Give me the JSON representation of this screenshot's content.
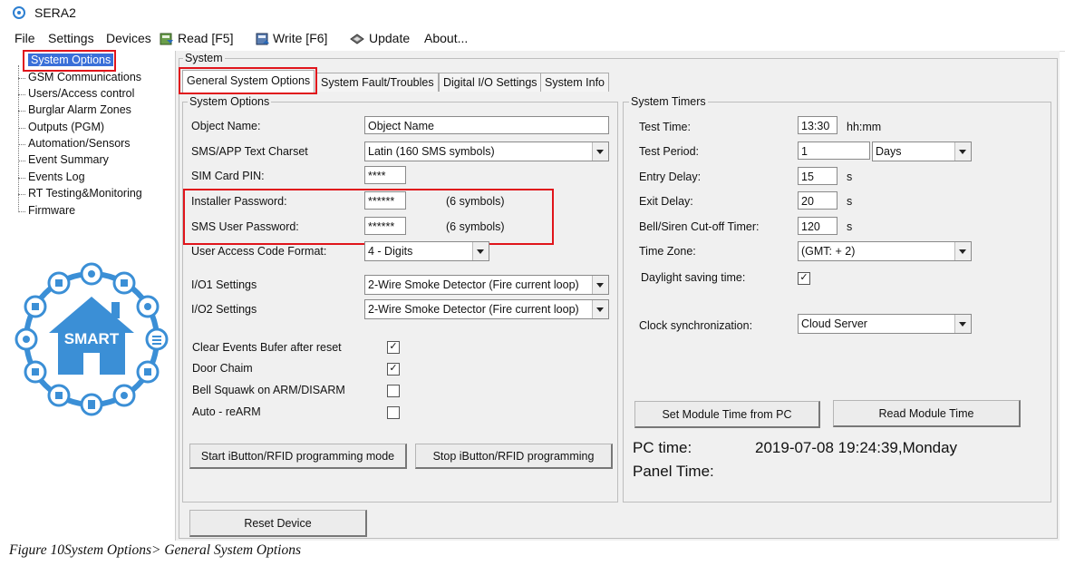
{
  "app": {
    "title": "SERA2"
  },
  "menu": {
    "file": "File",
    "settings": "Settings",
    "devices": "Devices",
    "read": "Read [F5]",
    "write": "Write [F6]",
    "update": "Update",
    "about": "About..."
  },
  "sidebar": {
    "items": [
      "System Options",
      "GSM Communications",
      "Users/Access control",
      "Burglar Alarm Zones",
      "Outputs (PGM)",
      "Automation/Sensors",
      "Event Summary",
      "Events Log",
      "RT Testing&Monitoring",
      "Firmware"
    ],
    "graphic_text": "SMART"
  },
  "main": {
    "group_title": "System",
    "tabs": [
      "General System Options",
      "System Fault/Troubles",
      "Digital I/O Settings",
      "System Info"
    ],
    "system_options": {
      "title": "System Options",
      "object_name_label": "Object Name:",
      "object_name_value": "Object Name",
      "charset_label": "SMS/APP Text Charset",
      "charset_value": "Latin (160 SMS symbols)",
      "sim_pin_label": "SIM Card PIN:",
      "sim_pin_value": "****",
      "installer_pw_label": "Installer Password:",
      "installer_pw_value": "******",
      "installer_pw_hint": "(6 symbols)",
      "sms_pw_label": "SMS User Password:",
      "sms_pw_value": "******",
      "sms_pw_hint": "(6 symbols)",
      "uac_label": "User Access Code Format:",
      "uac_value": "4 - Digits",
      "io1_label": "I/O1 Settings",
      "io1_value": "2-Wire Smoke Detector (Fire current loop)",
      "io2_label": "I/O2 Settings",
      "io2_value": "2-Wire Smoke Detector (Fire current loop)",
      "clear_events_label": "Clear Events Bufer after reset",
      "clear_events_checked": true,
      "door_chaim_label": "Door Chaim",
      "door_chaim_checked": true,
      "bell_squawk_label": "Bell Squawk on ARM/DISARM",
      "bell_squawk_checked": false,
      "auto_rearm_label": "Auto - reARM",
      "auto_rearm_checked": false,
      "start_ibutton": "Start iButton/RFID  programming mode",
      "stop_ibutton": "Stop iButton/RFID programming"
    },
    "system_timers": {
      "title": "System Timers",
      "test_time_label": "Test Time:",
      "test_time_value": "13:30",
      "test_time_unit": "hh:mm",
      "test_period_label": "Test Period:",
      "test_period_value": "1",
      "test_period_unit": "Days",
      "entry_delay_label": "Entry Delay:",
      "entry_delay_value": "15",
      "entry_delay_unit": "s",
      "exit_delay_label": "Exit Delay:",
      "exit_delay_value": "20",
      "exit_delay_unit": "s",
      "bell_cutoff_label": "Bell/Siren Cut-off Timer:",
      "bell_cutoff_value": "120",
      "bell_cutoff_unit": "s",
      "tz_label": "Time Zone:",
      "tz_value": "(GMT: + 2)",
      "dst_label": "Daylight saving time:",
      "dst_checked": true,
      "clock_sync_label": "Clock synchronization:",
      "clock_sync_value": "Cloud Server",
      "set_time_btn": "Set Module Time from PC",
      "read_time_btn": "Read Module Time",
      "pc_time_label": "PC time:",
      "pc_time_value": "2019-07-08 19:24:39,Monday",
      "panel_time_label": "Panel Time:"
    },
    "reset_btn": "Reset Device"
  },
  "caption": "Figure 10System Options> General System Options",
  "colors": {
    "highlight": "#e0141b",
    "selection": "#3a6fd8",
    "graphic": "#3b8fd6"
  }
}
